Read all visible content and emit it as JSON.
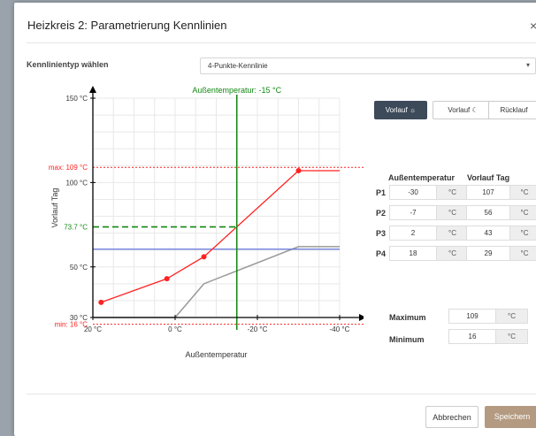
{
  "dialog": {
    "title": "Heizkreis 2: Parametrierung Kennlinien",
    "close_symbol": "×"
  },
  "kennlinie": {
    "label": "Kennlinientyp wählen",
    "selected": "4-Punkte-Kennlinie"
  },
  "tabs": [
    {
      "label": "Vorlauf ☼",
      "active": true
    },
    {
      "label": "Vorlauf ☾",
      "active": false
    },
    {
      "label": "Rücklauf",
      "active": false
    }
  ],
  "points_table": {
    "header_outside": "Außentemperatur",
    "header_flow": "Vorlauf Tag",
    "unit": "°C",
    "rows": [
      {
        "label": "P1",
        "outside": "-30",
        "flow": "107"
      },
      {
        "label": "P2",
        "outside": "-7",
        "flow": "56"
      },
      {
        "label": "P3",
        "outside": "2",
        "flow": "43"
      },
      {
        "label": "P4",
        "outside": "18",
        "flow": "29"
      }
    ]
  },
  "limits": {
    "max_label": "Maximum",
    "max_value": "109",
    "min_label": "Minimum",
    "min_value": "16",
    "unit": "°C"
  },
  "footer": {
    "cancel_label": "Abbrechen",
    "save_label": "Speichern"
  },
  "colors": {
    "accent_dark": "#3c4a5a",
    "save_button": "#b39a80",
    "curve": "#ff2222",
    "outside_marker": "#118811",
    "blue_line": "#6677dd",
    "gray_line": "#999999"
  },
  "chart_data": {
    "type": "line",
    "xlabel": "Außentemperatur",
    "ylabel": "Vorlauf Tag",
    "x_ticks": [
      "20 °C",
      "0 °C",
      "-20 °C",
      "-40 °C"
    ],
    "y_ticks": [
      "30 °C",
      "50 °C",
      "100 °C",
      "150 °C"
    ],
    "xlim": [
      20,
      -40
    ],
    "ylim": [
      16,
      150
    ],
    "grid": true,
    "series": [
      {
        "x": [
          18,
          2,
          -7,
          -30,
          -40
        ],
        "y": [
          29,
          43,
          56,
          107,
          107
        ]
      },
      {
        "x": [
          20,
          2,
          -7,
          -30,
          -40
        ],
        "y": [
          60.5,
          60.5,
          60.5,
          60.5,
          60.5
        ]
      },
      {
        "x": [
          20,
          10,
          0,
          -7,
          -30,
          -40
        ],
        "y": [
          20,
          20,
          20,
          40,
          62,
          62
        ]
      }
    ],
    "annotations": {
      "outside_temp_label": "Außentemperatur: -15 °C",
      "outside_temp": -15,
      "current_flow_label": "73.7 °C",
      "current_flow": 73.7,
      "max_label": "max: 109 °C",
      "max": 109,
      "min_label": "min: 16 °C",
      "min": 16
    }
  }
}
